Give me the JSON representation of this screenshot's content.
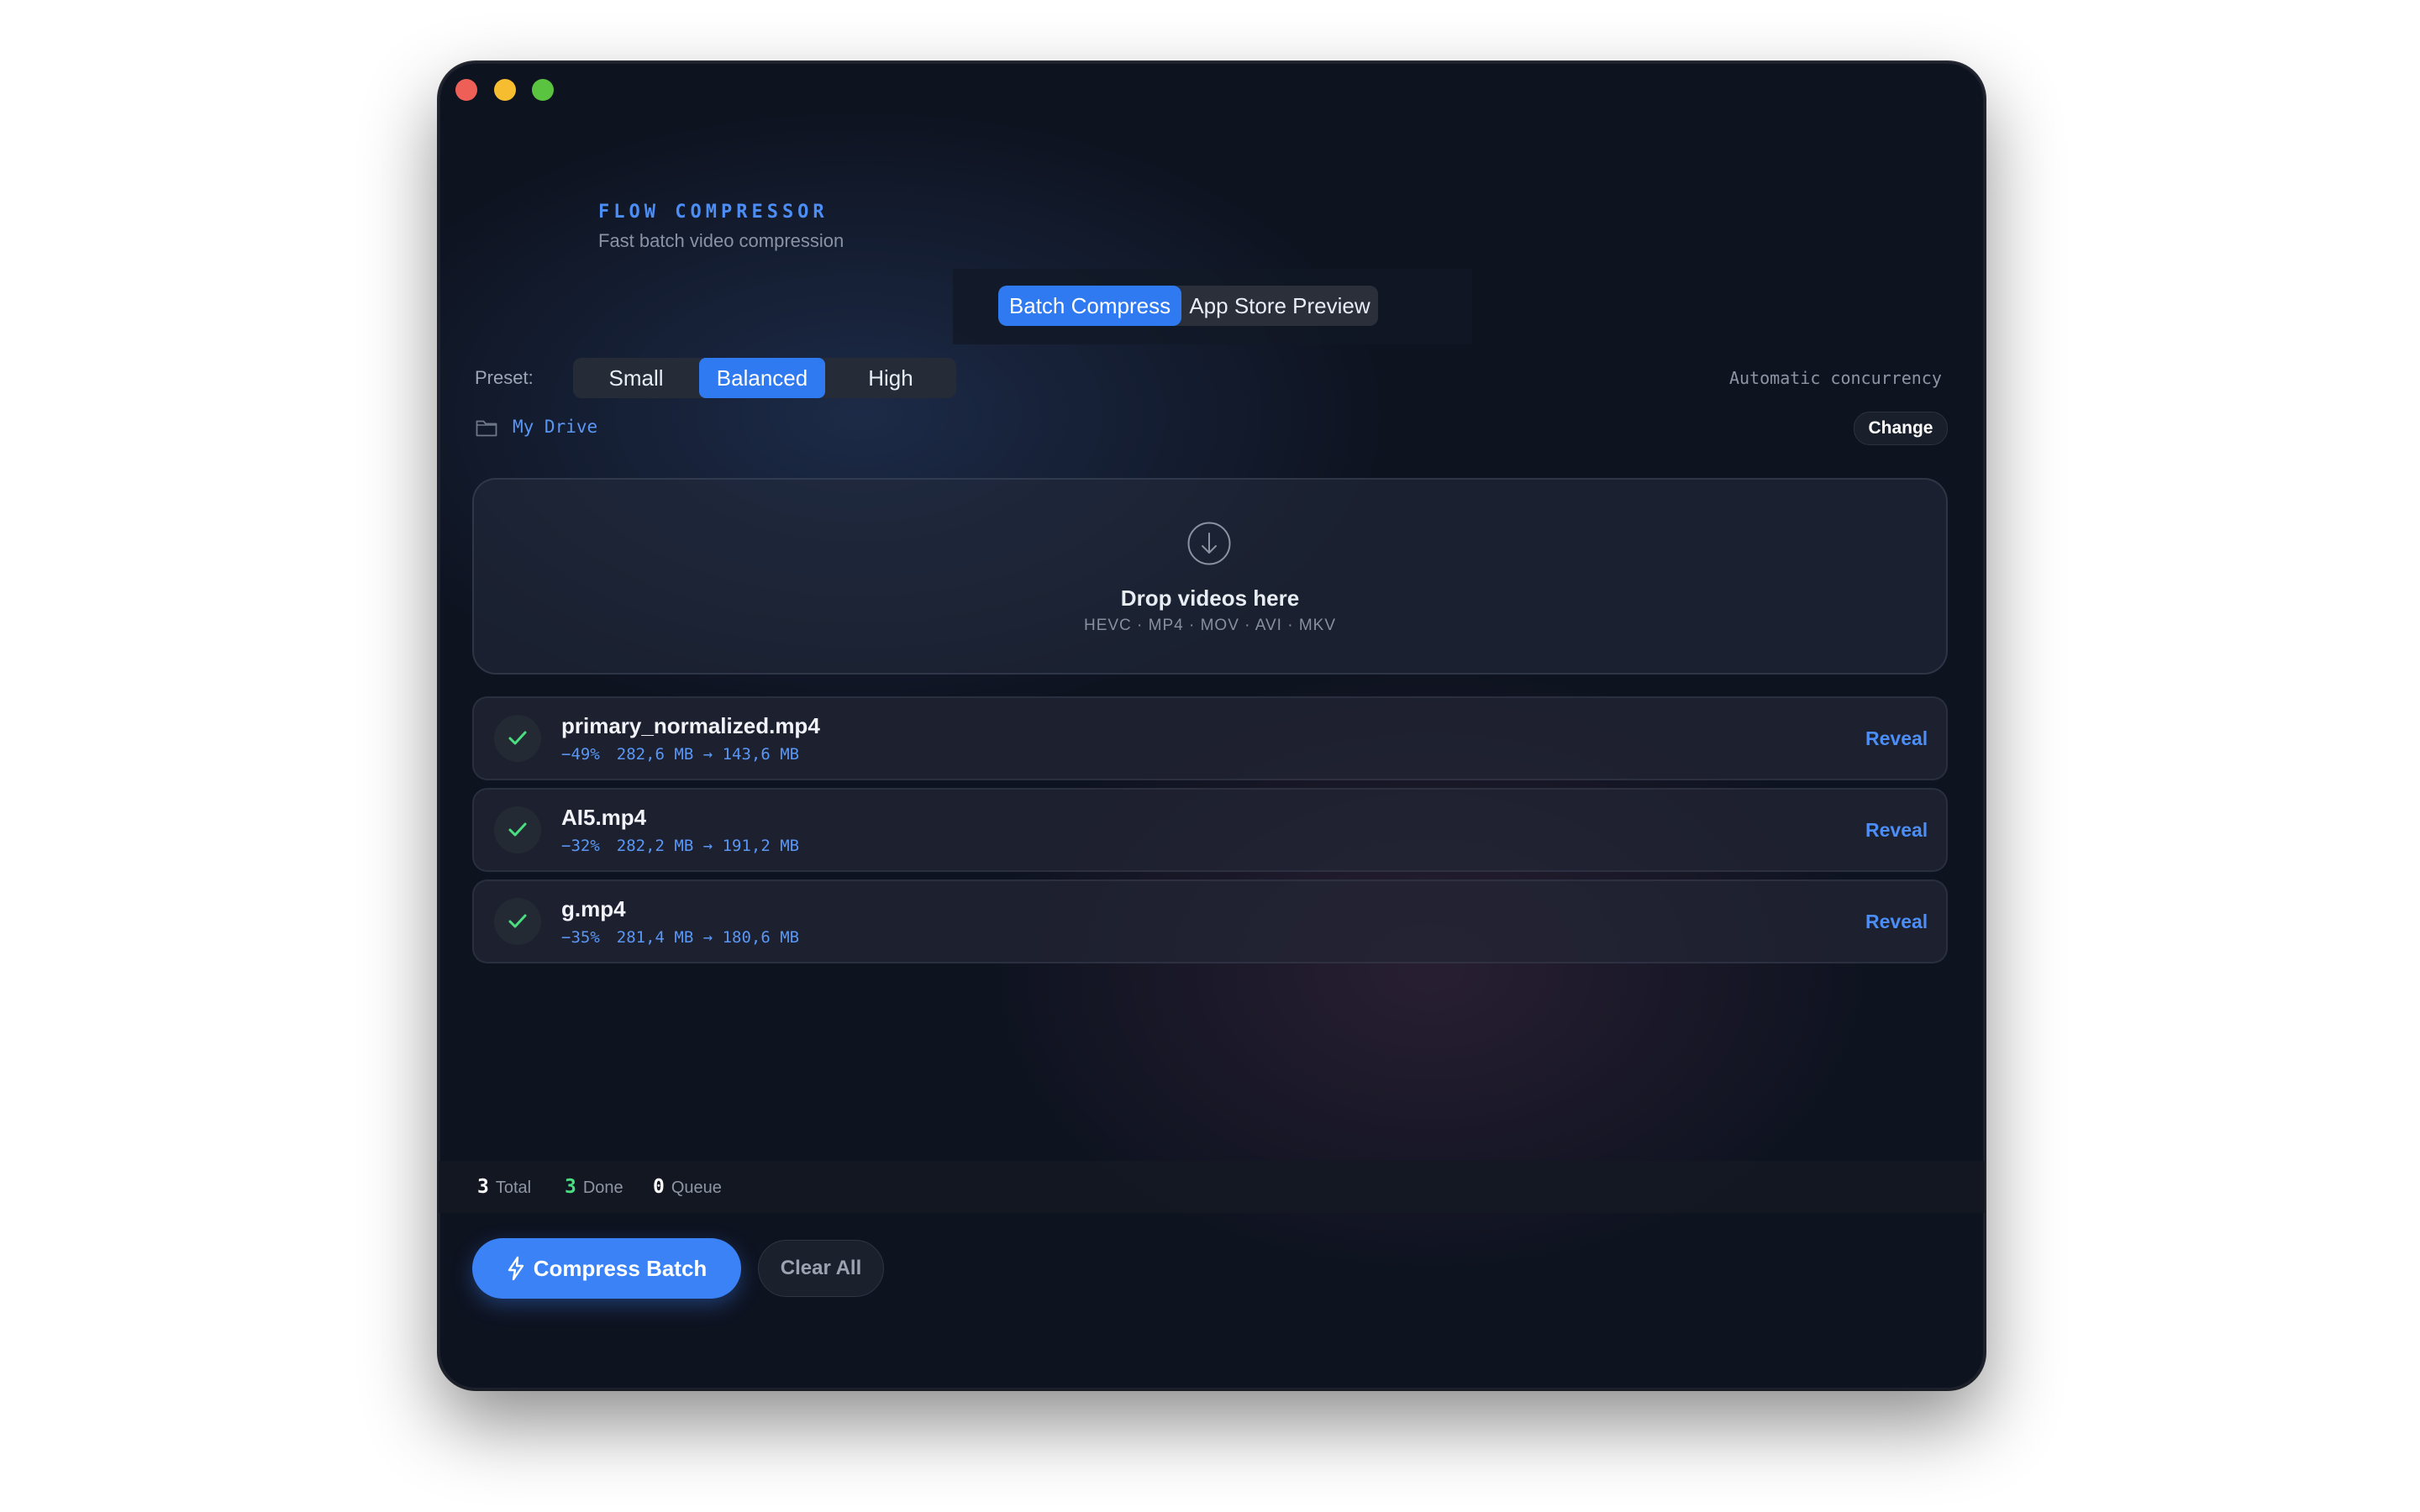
{
  "app": {
    "title": "FLOW COMPRESSOR",
    "subtitle": "Fast batch video compression"
  },
  "mode_tabs": [
    {
      "label": "Batch Compress",
      "active": true
    },
    {
      "label": "App Store Preview",
      "active": false
    }
  ],
  "preset": {
    "label": "Preset:",
    "options": [
      {
        "label": "Small",
        "active": false
      },
      {
        "label": "Balanced",
        "active": true
      },
      {
        "label": "High",
        "active": false
      }
    ]
  },
  "concurrency_label": "Automatic concurrency",
  "output": {
    "folder": "My Drive",
    "change_label": "Change"
  },
  "dropzone": {
    "title": "Drop videos here",
    "formats": "HEVC · MP4 · MOV · AVI · MKV"
  },
  "files": [
    {
      "name": "primary_normalized.mp4",
      "reduction": "−49%",
      "sizes": "282,6 MB → 143,6 MB",
      "action": "Reveal",
      "status": "done"
    },
    {
      "name": "AI5.mp4",
      "reduction": "−32%",
      "sizes": "282,2 MB → 191,2 MB",
      "action": "Reveal",
      "status": "done"
    },
    {
      "name": "g.mp4",
      "reduction": "−35%",
      "sizes": "281,4 MB → 180,6 MB",
      "action": "Reveal",
      "status": "done"
    }
  ],
  "stats": {
    "total": {
      "value": "3",
      "label": "Total"
    },
    "done": {
      "value": "3",
      "label": "Done"
    },
    "queue": {
      "value": "0",
      "label": "Queue"
    }
  },
  "actions": {
    "compress_label": "Compress Batch",
    "clear_label": "Clear All"
  },
  "colors": {
    "accent": "#3b82f6",
    "success": "#4ade80",
    "background": "#0e1320"
  }
}
